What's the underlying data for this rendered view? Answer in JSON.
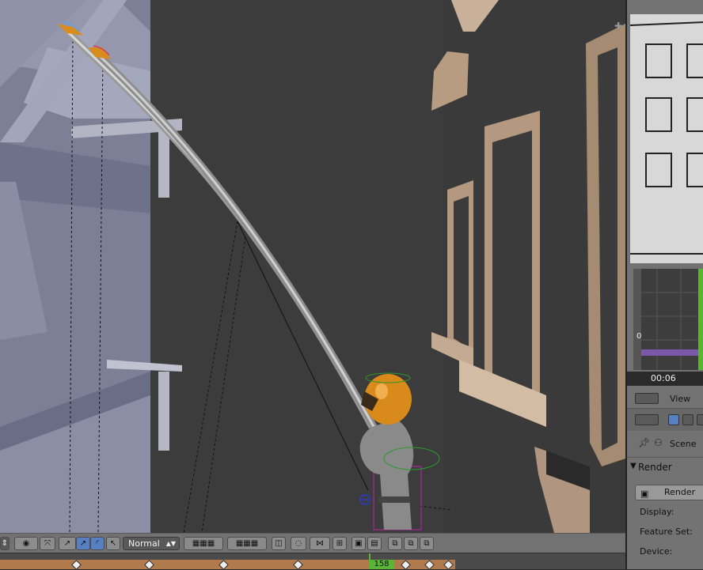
{
  "viewport": {
    "corner_icon": "plus-icon"
  },
  "header": {
    "mode_select": "Normal",
    "icons": [
      "object-mode-icon",
      "viewport-shading-icon",
      "pivot-icon",
      "manipulator-icon",
      "translate-icon",
      "rotate-icon",
      "scale-icon",
      "layer-grid-icon",
      "layers-grid-icon",
      "layer-icon",
      "proportional-icon",
      "snap-icon",
      "snap-target-icon",
      "render-still-icon",
      "render-anim-icon",
      "copy-icon",
      "paste-icon",
      "paste-flipped-icon"
    ]
  },
  "timeline": {
    "current_frame": "158"
  },
  "right_panel": {
    "time_readout": "00:06",
    "graph_axis_zero": "0",
    "view_label": "View",
    "scene_label": "Scene",
    "render_section_title": "Render",
    "render_button_label": "Render",
    "display_label": "Display:",
    "feature_set_label": "Feature Set:",
    "device_label": "Device:"
  },
  "colors": {
    "accent_blue": "#5680c2",
    "frame_green": "#5ab536",
    "timeline_orange": "#b07a4c"
  }
}
